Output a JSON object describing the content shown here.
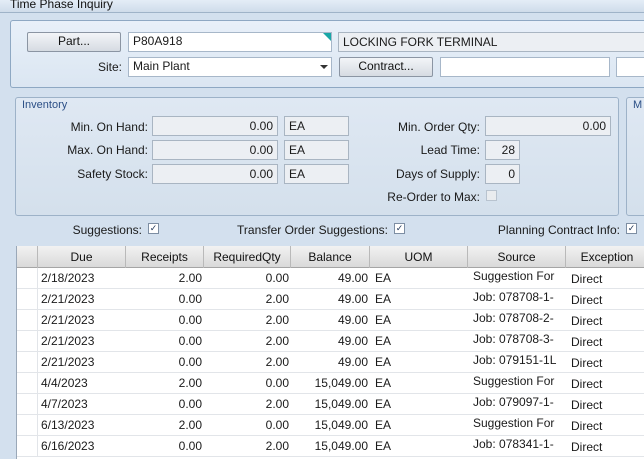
{
  "window": {
    "title": "Time Phase Inquiry"
  },
  "header": {
    "part_button": "Part...",
    "part_value": "P80A918",
    "part_description": "LOCKING FORK TERMINAL",
    "site_label": "Site:",
    "site_value": "Main Plant",
    "contract_button": "Contract...",
    "contract_value": ""
  },
  "inventory": {
    "title": "Inventory",
    "min_on_hand_label": "Min. On Hand:",
    "min_on_hand": "0.00",
    "min_on_hand_uom": "EA",
    "max_on_hand_label": "Max. On Hand:",
    "max_on_hand": "0.00",
    "max_on_hand_uom": "EA",
    "safety_stock_label": "Safety Stock:",
    "safety_stock": "0.00",
    "safety_stock_uom": "EA",
    "min_order_qty_label": "Min. Order Qty:",
    "min_order_qty": "0.00",
    "lead_time_label": "Lead Time:",
    "lead_time": "28",
    "days_of_supply_label": "Days of Supply:",
    "days_of_supply": "0",
    "reorder_to_max_label": "Re-Order to Max:"
  },
  "right_group": {
    "title": "M"
  },
  "options": {
    "suggestions_label": "Suggestions:",
    "transfer_label": "Transfer Order Suggestions:",
    "planning_label": "Planning Contract Info:",
    "check_glyph": "✓"
  },
  "grid": {
    "columns": [
      "Due",
      "Receipts",
      "RequiredQty",
      "Balance",
      "UOM",
      "Source",
      "Exception"
    ],
    "rows": [
      [
        "2/18/2023",
        "2.00",
        "0.00",
        "49.00",
        "EA",
        "Suggestion For",
        "Direct"
      ],
      [
        "2/21/2023",
        "0.00",
        "2.00",
        "49.00",
        "EA",
        "Job: 078708-1-",
        "Direct"
      ],
      [
        "2/21/2023",
        "0.00",
        "2.00",
        "49.00",
        "EA",
        "Job: 078708-2-",
        "Direct"
      ],
      [
        "2/21/2023",
        "0.00",
        "2.00",
        "49.00",
        "EA",
        "Job: 078708-3-",
        "Direct"
      ],
      [
        "2/21/2023",
        "0.00",
        "2.00",
        "49.00",
        "EA",
        "Job: 079151-1L",
        "Direct"
      ],
      [
        "4/4/2023",
        "2.00",
        "0.00",
        "15,049.00",
        "EA",
        "Suggestion For",
        "Direct"
      ],
      [
        "4/7/2023",
        "0.00",
        "2.00",
        "15,049.00",
        "EA",
        "Job: 079097-1-",
        "Direct"
      ],
      [
        "6/13/2023",
        "2.00",
        "0.00",
        "15,049.00",
        "EA",
        "Suggestion For",
        "Direct"
      ],
      [
        "6/16/2023",
        "0.00",
        "2.00",
        "15,049.00",
        "EA",
        "Job: 078341-1-",
        "Direct"
      ]
    ]
  }
}
